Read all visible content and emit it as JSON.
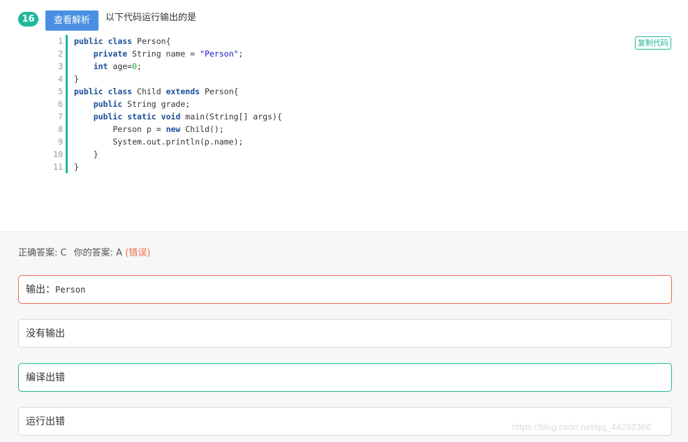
{
  "question": {
    "number": "16",
    "analyze_label": "查看解析",
    "title": "以下代码运行输出的是",
    "copy_label": "复制代码"
  },
  "code": {
    "line_numbers": [
      "1",
      "2",
      "3",
      "4",
      "5",
      "6",
      "7",
      "8",
      "9",
      "10",
      "11"
    ],
    "lines": [
      "public class Person{",
      "    private String name = \"Person\";",
      "    int age=0;",
      "}",
      "public class Child extends Person{",
      "    public String grade;",
      "    public static void main(String[] args){",
      "        Person p = new Child();",
      "        System.out.println(p.name);",
      "    }",
      "}"
    ]
  },
  "result": {
    "correct_label": "正确答案: C",
    "yours_label": "你的答案: A",
    "wrong_tag": "(错误)"
  },
  "options": {
    "a_prefix": "输出：",
    "a_value": "Person",
    "b": "没有输出",
    "c": "编译出错",
    "d": "运行出错"
  },
  "watermark": "https://blog.csdn.net/qq_44292366",
  "colors": {
    "accent": "#1fb89a",
    "button_blue": "#4a90e2",
    "error": "#ef6a4f"
  }
}
